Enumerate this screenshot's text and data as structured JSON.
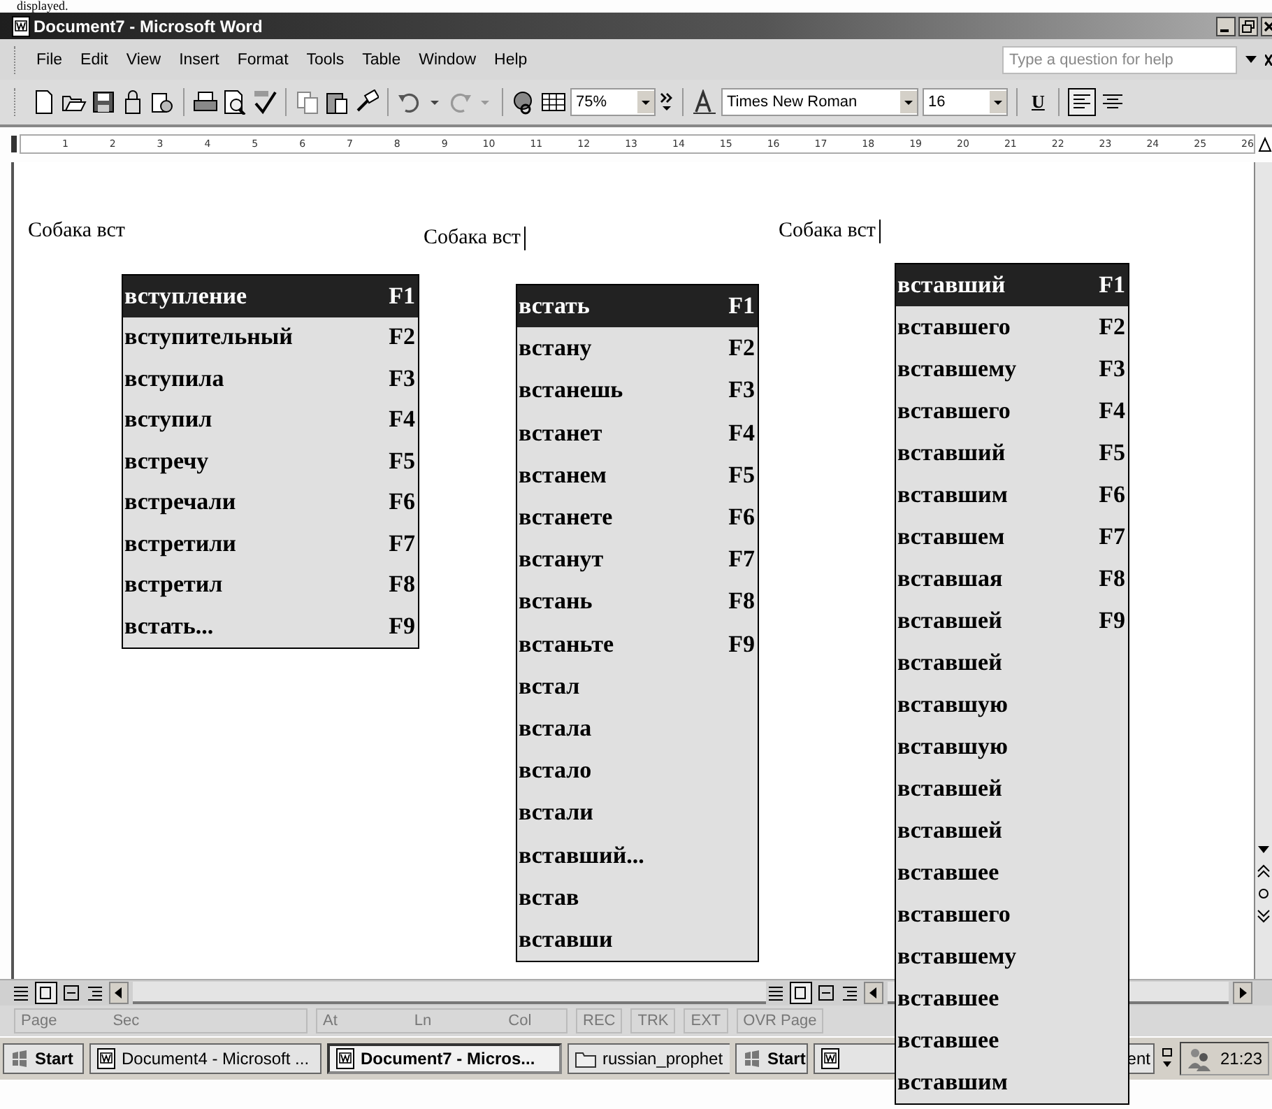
{
  "caption": "displayed.",
  "window": {
    "title": "Document7 - Microsoft Word"
  },
  "menu": [
    "File",
    "Edit",
    "View",
    "Insert",
    "Format",
    "Tools",
    "Table",
    "Window",
    "Help"
  ],
  "help_box": {
    "placeholder": "Type a question for help"
  },
  "toolbar": {
    "zoom": "75%",
    "font": "Times New Roman",
    "size": "16",
    "underline": "U"
  },
  "ruler": [
    "1",
    "2",
    "3",
    "4",
    "5",
    "6",
    "7",
    "8",
    "9",
    "10",
    "11",
    "12",
    "13",
    "14",
    "15",
    "16",
    "17",
    "18",
    "19",
    "20",
    "21",
    "22",
    "23",
    "24",
    "25",
    "26"
  ],
  "snippets": [
    {
      "text": "Собака вст",
      "cursor": false
    },
    {
      "text": "Собака вст",
      "cursor": true
    },
    {
      "text": "Собака вст",
      "cursor": true
    }
  ],
  "lists": [
    {
      "items": [
        {
          "word": "вступление",
          "key": "F1",
          "selected": true
        },
        {
          "word": "вступительный",
          "key": "F2",
          "selected": false
        },
        {
          "word": "вступила",
          "key": "F3",
          "selected": false
        },
        {
          "word": "вступил",
          "key": "F4",
          "selected": false
        },
        {
          "word": "встречу",
          "key": "F5",
          "selected": false
        },
        {
          "word": "встречали",
          "key": "F6",
          "selected": false
        },
        {
          "word": "встретили",
          "key": "F7",
          "selected": false
        },
        {
          "word": "встретил",
          "key": "F8",
          "selected": false
        },
        {
          "word": "встать...",
          "key": "F9",
          "selected": false
        }
      ]
    },
    {
      "items": [
        {
          "word": "встать",
          "key": "F1",
          "selected": true
        },
        {
          "word": "встану",
          "key": "F2",
          "selected": false
        },
        {
          "word": "встанешь",
          "key": "F3",
          "selected": false
        },
        {
          "word": "встанет",
          "key": "F4",
          "selected": false
        },
        {
          "word": "встанем",
          "key": "F5",
          "selected": false
        },
        {
          "word": "встанете",
          "key": "F6",
          "selected": false
        },
        {
          "word": "встанут",
          "key": "F7",
          "selected": false
        },
        {
          "word": "встань",
          "key": "F8",
          "selected": false
        },
        {
          "word": "встаньте",
          "key": "F9",
          "selected": false
        },
        {
          "word": "встал",
          "selected": false
        },
        {
          "word": "встала",
          "selected": false
        },
        {
          "word": "встало",
          "selected": false
        },
        {
          "word": "встали",
          "selected": false
        },
        {
          "word": "вставший...",
          "selected": false
        },
        {
          "word": "встав",
          "selected": false
        },
        {
          "word": "вставши",
          "selected": false
        }
      ]
    },
    {
      "items": [
        {
          "word": "вставший",
          "key": "F1",
          "selected": true
        },
        {
          "word": "вставшего",
          "key": "F2",
          "selected": false
        },
        {
          "word": "вставшему",
          "key": "F3",
          "selected": false
        },
        {
          "word": "вставшего",
          "key": "F4",
          "selected": false
        },
        {
          "word": "вставший",
          "key": "F5",
          "selected": false
        },
        {
          "word": "вставшим",
          "key": "F6",
          "selected": false
        },
        {
          "word": "вставшем",
          "key": "F7",
          "selected": false
        },
        {
          "word": "вставшая",
          "key": "F8",
          "selected": false
        },
        {
          "word": "вставшей",
          "key": "F9",
          "selected": false
        },
        {
          "word": "вставшей",
          "selected": false
        },
        {
          "word": "вставшую",
          "selected": false
        },
        {
          "word": "вставшую",
          "selected": false
        },
        {
          "word": "вставшей",
          "selected": false
        },
        {
          "word": "вставшей",
          "selected": false
        },
        {
          "word": "вставшее",
          "selected": false
        },
        {
          "word": "вставшего",
          "selected": false
        },
        {
          "word": "вставшему",
          "selected": false
        },
        {
          "word": "вставшее",
          "selected": false
        },
        {
          "word": "вставшее",
          "selected": false
        },
        {
          "word": "вставшим",
          "selected": false
        }
      ]
    }
  ],
  "status_bar": [
    "Page",
    "Sec",
    "At",
    "Ln",
    "Col",
    "REC",
    "TRK",
    "EXT",
    "OVR Page"
  ],
  "taskbar": [
    {
      "kind": "start",
      "label": "Start",
      "selected": false
    },
    {
      "kind": "doc",
      "label": "Document4 - Microsoft ...",
      "selected": false
    },
    {
      "kind": "doc",
      "label": "Document7 - Micros...",
      "selected": true
    },
    {
      "kind": "folder",
      "label": "russian_prophet",
      "selected": false
    },
    {
      "kind": "start",
      "label": "Start",
      "selected": false
    },
    {
      "kind": "doc",
      "label": "ent",
      "selected": false
    }
  ],
  "clock": "21:23"
}
